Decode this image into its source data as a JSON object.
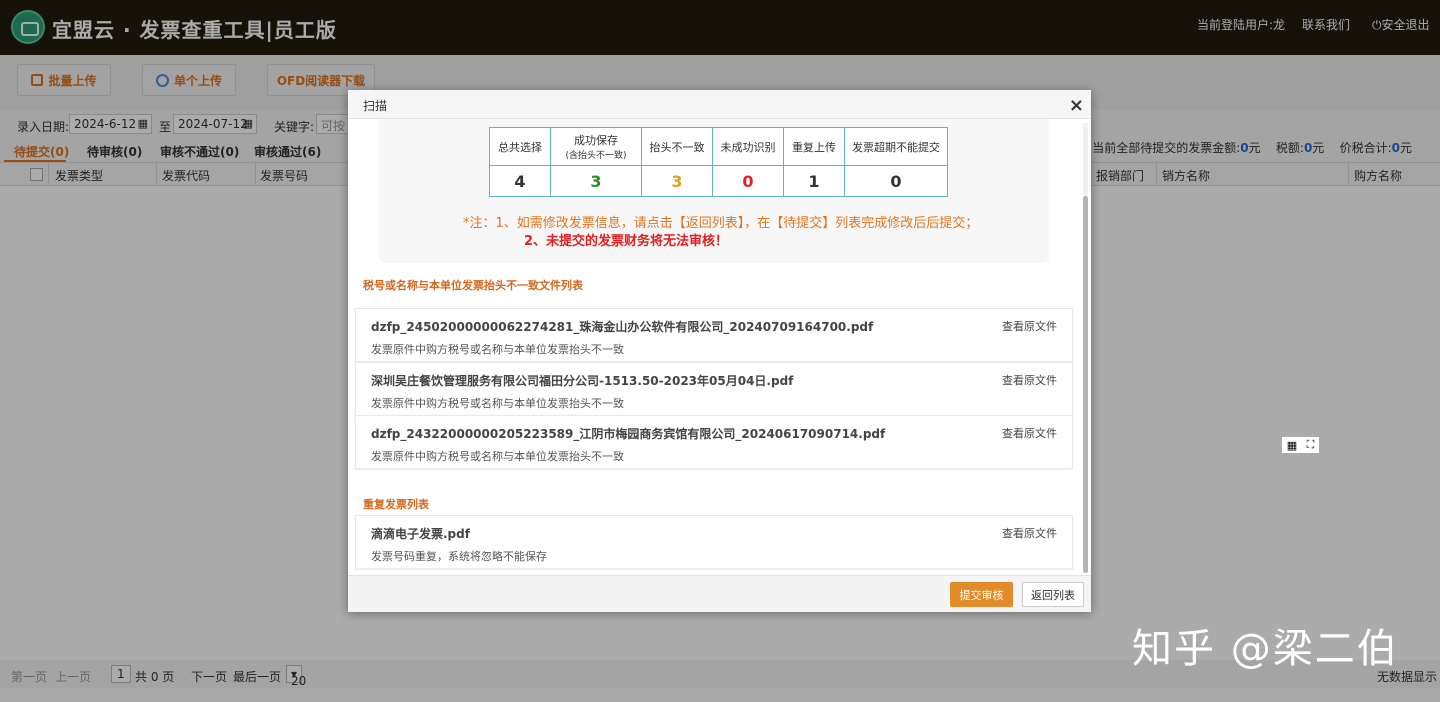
{
  "header": {
    "app_title": "宜盟云 · 发票查重工具|员工版",
    "user_label": "当前登陆用户:龙",
    "contact": "联系我们",
    "logout": "安全退出"
  },
  "toolbar": {
    "batch_upload": "批量上传",
    "single_upload": "单个上传",
    "ofd_download": "OFD阅读器下载"
  },
  "filter": {
    "date_label": "录入日期:",
    "date_from": "2024-6-12",
    "to_label": "至",
    "date_to": "2024-07-12",
    "keyword_label": "关键字:",
    "keyword_placeholder": "可按发"
  },
  "tabs": [
    "待提交(0)",
    "待审核(0)",
    "审核不通过(0)",
    "审核通过(6)"
  ],
  "summary": {
    "pending_label": "当前全部待提交的发票金额:",
    "pending_value": "0",
    "unit": "元",
    "tax_label": "税额:",
    "tax_value": "0",
    "total_label": "价税合计:",
    "total_value": "0"
  },
  "table": {
    "columns": [
      "发票类型",
      "发票代码",
      "发票号码",
      "报销部门",
      "销方名称",
      "购方名称"
    ]
  },
  "pager": {
    "first": "第一页",
    "prev": "上一页",
    "page": "1",
    "total_pages": "共 0 页",
    "next": "下一页",
    "last": "最后一页",
    "page_size": "20",
    "no_data": "无数据显示"
  },
  "watermark": "知乎 @梁二伯",
  "modal": {
    "title": "扫描",
    "close": "×",
    "stats": {
      "headers": [
        "总共选择",
        "成功保存",
        "抬头不一致",
        "未成功识别",
        "重复上传",
        "发票超期不能提交"
      ],
      "header_sub": "(含抬头不一致)",
      "values": [
        "4",
        "3",
        "3",
        "0",
        "1",
        "0"
      ],
      "value_colors": [
        "#333333",
        "#2e8b2e",
        "#e0a020",
        "#e02020",
        "#333333",
        "#333333"
      ]
    },
    "note_line1": "*注：1、如需修改发票信息，请点击【返回列表】，在【待提交】列表完成修改后后提交；",
    "note_line2": "2、未提交的发票财务将无法审核！",
    "mismatch_title": "税号或名称与本单位发票抬头不一致文件列表",
    "mismatch_files": [
      {
        "name": "dzfp_24502000000062274281_珠海金山办公软件有限公司_20240709164700.pdf",
        "desc": "发票原件中购方税号或名称与本单位发票抬头不一致",
        "action": "查看原文件"
      },
      {
        "name": "深圳吴庄餐饮管理服务有限公司福田分公司-1513.50-2023年05月04日.pdf",
        "desc": "发票原件中购方税号或名称与本单位发票抬头不一致",
        "action": "查看原文件"
      },
      {
        "name": "dzfp_24322000000205223589_江阴市梅园商务宾馆有限公司_20240617090714.pdf",
        "desc": "发票原件中购方税号或名称与本单位发票抬头不一致",
        "action": "查看原文件"
      }
    ],
    "duplicate_title": "重复发票列表",
    "duplicate_files": [
      {
        "name": "滴滴电子发票.pdf",
        "desc": "发票号码重复，系统将忽略不能保存",
        "action": "查看原文件"
      }
    ],
    "submit": "提交审核",
    "back": "返回列表"
  }
}
